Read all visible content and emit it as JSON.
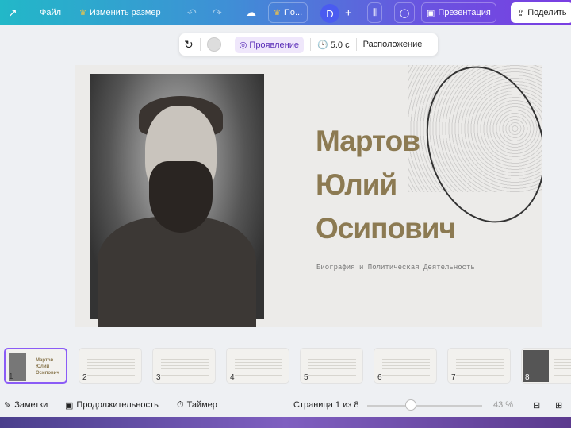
{
  "topbar": {
    "file": "Файл",
    "resize": "Изменить размер",
    "plan": "По...",
    "avatar": "D",
    "add": "+",
    "present": "Презентация",
    "share": "Поделить"
  },
  "context": {
    "animation": "Проявление",
    "duration": "5.0 с",
    "position": "Расположение"
  },
  "slide": {
    "title_lines": [
      "Мартов",
      "Юлий",
      "Осипович"
    ],
    "subtitle": "Биография и Политическая Деятельность"
  },
  "thumbnails": [
    "1",
    "2",
    "3",
    "4",
    "5",
    "6",
    "7",
    "8"
  ],
  "bottom": {
    "notes": "Заметки",
    "duration": "Продолжительность",
    "timer": "Таймер",
    "page": "Страница 1 из 8",
    "zoom": "43 %",
    "zoom_fraction": 0.43
  },
  "colors": {
    "accent": "#8b5cf6",
    "title": "#8c7a52"
  }
}
